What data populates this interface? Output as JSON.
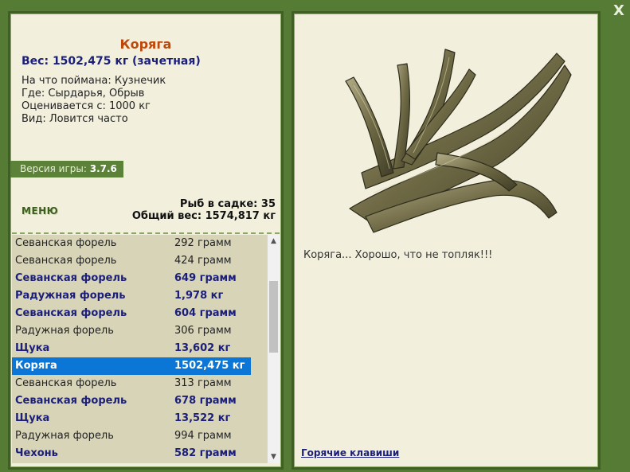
{
  "close_label": "X",
  "catch": {
    "name": "Коряга",
    "weight": "Вес: 1502,475 кг (зачетная)",
    "caught_on": "На что поймана: Кузнечик",
    "where": "Где: Сырдарья, Обрыв",
    "valued": "Оценивается с: 1000 кг",
    "kind": "Вид: Ловится часто"
  },
  "version": {
    "label": "Версия игры:",
    "value": "3.7.6"
  },
  "menu_label": "МЕНЮ",
  "keep": {
    "count": "Рыб в садке: 35",
    "total": "Общий вес: 1574,817 кг"
  },
  "fish_list": [
    {
      "name": "Севанская форель",
      "weight": "292 грамм",
      "bold": false,
      "selected": false
    },
    {
      "name": "Севанская форель",
      "weight": "424 грамм",
      "bold": false,
      "selected": false
    },
    {
      "name": "Севанская форель",
      "weight": "649 грамм",
      "bold": true,
      "selected": false
    },
    {
      "name": "Радужная форель",
      "weight": "1,978 кг",
      "bold": true,
      "selected": false
    },
    {
      "name": "Севанская форель",
      "weight": "604 грамм",
      "bold": true,
      "selected": false
    },
    {
      "name": "Радужная форель",
      "weight": "306 грамм",
      "bold": false,
      "selected": false
    },
    {
      "name": "Щука",
      "weight": "13,602 кг",
      "bold": true,
      "selected": false
    },
    {
      "name": "Коряга",
      "weight": "1502,475 кг",
      "bold": true,
      "selected": true
    },
    {
      "name": "Севанская форель",
      "weight": "313 грамм",
      "bold": false,
      "selected": false
    },
    {
      "name": "Севанская форель",
      "weight": "678 грамм",
      "bold": true,
      "selected": false
    },
    {
      "name": "Щука",
      "weight": "13,522 кг",
      "bold": true,
      "selected": false
    },
    {
      "name": "Радужная форель",
      "weight": "994 грамм",
      "bold": false,
      "selected": false
    },
    {
      "name": "Чехонь",
      "weight": "582 грамм",
      "bold": true,
      "selected": false
    }
  ],
  "comment": "Коряга... Хорошо, что не топляк!!!",
  "hotkeys_label": "Горячие клавиши",
  "image": {
    "subject": "driftwood-snag"
  }
}
